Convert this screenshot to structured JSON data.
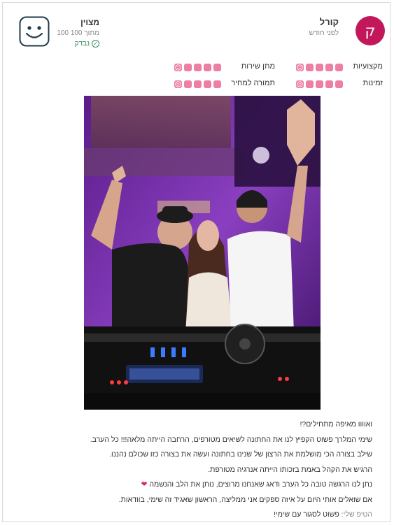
{
  "reviewer": {
    "avatar_letter": "ק",
    "name": "קורל",
    "date": "לפני חודש",
    "avatar_color": "#c2185b"
  },
  "score": {
    "label": "מצוין",
    "value": "100 מתוך 100",
    "verified_label": "נבדק",
    "icon": "smiley-face-icon"
  },
  "ratings": [
    {
      "label": "מקצועיות",
      "level": 5,
      "max": 5
    },
    {
      "label": "מתן שירות",
      "level": 5,
      "max": 5
    },
    {
      "label": "זמינות",
      "level": 5,
      "max": 5
    },
    {
      "label": "תמורה למחיר",
      "level": 5,
      "max": 5
    }
  ],
  "photo": {
    "icon": "event-photo-icon"
  },
  "review": {
    "lines": [
      "ואוווו מאיפה מתחילים?!",
      "שימי המלרך פשוט הקפיץ לנו את החתונה לשיאים מטורפים, הרחבה הייתה מלאה!!! כל הערב.",
      "שילב בצורה הכי מושלמת את הרצון של שנינו בחתונה ועשה את בצורה כזו שכולם נהננו.",
      "הרגיש את הקהל באמת בזכותו הייתה אנרגיה מטורפת.",
      "נתן לנו הרגשה טובה כל הערב ודאג שאנחנו מרוצים, נותן את הלב והנשמה",
      "אם שואלים אותי היום על איזה ספקים אני ממליצה, הראשון שאגיד זה שימי, בוודאות."
    ],
    "heart": "❤",
    "tip_label": "הטיפ שלי:",
    "tip_text": "פשוט לסגור עם שימי!"
  },
  "colors": {
    "accent": "#ec7fa3",
    "verified": "#2e8b57"
  }
}
